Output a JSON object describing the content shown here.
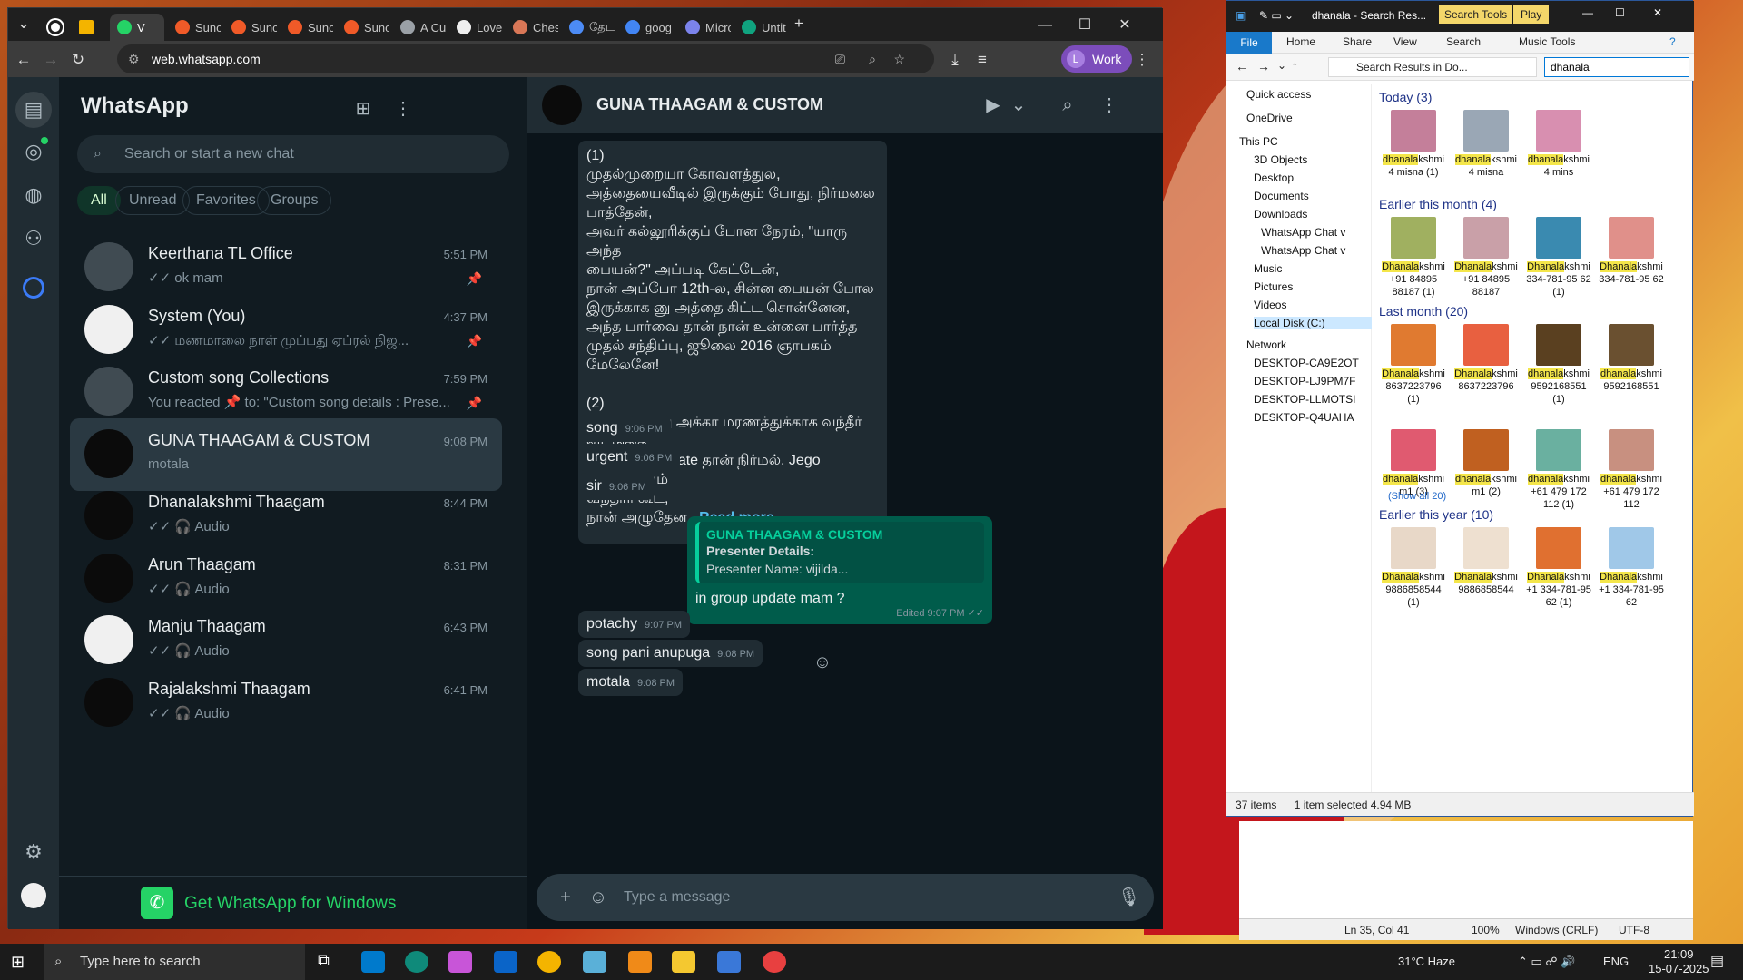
{
  "browser": {
    "tabs": [
      {
        "label": "V",
        "color": "#25d366"
      },
      {
        "label": "Suno",
        "color": "#f05a28"
      },
      {
        "label": "Suno",
        "color": "#f05a28"
      },
      {
        "label": "Suno",
        "color": "#f05a28"
      },
      {
        "label": "Suno",
        "color": "#f05a28"
      },
      {
        "label": "A Cus",
        "color": "#9aa0a6"
      },
      {
        "label": "Love",
        "color": "#eeeeee"
      },
      {
        "label": "Ches",
        "color": "#d97757"
      },
      {
        "label": "தேட",
        "color": "#4c8bf5"
      },
      {
        "label": "goog",
        "color": "#4285f4"
      },
      {
        "label": "Micro",
        "color": "#7b83eb"
      },
      {
        "label": "Untit",
        "color": "#10a37f"
      }
    ],
    "url": "web.whatsapp.com",
    "profile_initial": "L",
    "profile_label": "Work"
  },
  "whatsapp": {
    "title": "WhatsApp",
    "search_placeholder": "Search or start a new chat",
    "filters": [
      "All",
      "Unread",
      "Favorites",
      "Groups"
    ],
    "chats": [
      {
        "name": "Keerthana TL Office",
        "time": "5:51 PM",
        "snippet": "✓✓ ok mam",
        "pinned": true
      },
      {
        "name": "System (You)",
        "time": "4:37 PM",
        "snippet": "✓✓ மணமாலை நாள் முப்பது ஏப்ரல் நிஜ...",
        "pinned": true
      },
      {
        "name": "Custom song Collections",
        "time": "7:59 PM",
        "snippet": "You reacted 📌 to: \"Custom song details : Prese...",
        "pinned": true
      },
      {
        "name": "GUNA THAAGAM & CUSTOM",
        "time": "9:08 PM",
        "snippet": "motala",
        "pinned": false
      },
      {
        "name": "Dhanalakshmi Thaagam",
        "time": "8:44 PM",
        "snippet": "✓✓ 🎧 Audio",
        "pinned": false
      },
      {
        "name": "Arun Thaagam",
        "time": "8:31 PM",
        "snippet": "✓✓ 🎧 Audio",
        "pinned": false
      },
      {
        "name": "Manju Thaagam",
        "time": "6:43 PM",
        "snippet": "✓✓ 🎧 Audio",
        "pinned": false
      },
      {
        "name": "Rajalakshmi Thaagam",
        "time": "6:41 PM",
        "snippet": "✓✓ 🎧 Audio",
        "pinned": false
      }
    ],
    "get_app": "Get WhatsApp for Windows",
    "conversation": {
      "title": "GUNA THAAGAM & CUSTOM",
      "long_message": "(1)\nமுதல்முறையா கோவளத்துல,\nஅத்தையைவீடில் இருக்கும் போது, நிர்மலை\nபாத்தேன்,\nஅவர் கல்லூரிக்குப் போன நேரம், \"யாரு அந்த\nபையன்?\" அப்படி கேட்டேன்,\nநான் அப்போ 12th-ல, சின்ன பையன் போல\nஇருக்காக னு அத்தை கிட்ட சொன்னேன,\nஅந்த பார்வை தான் நான் உன்னை பார்த்த\nமுதல் சந்திப்பு, ஜூலை 2016 ஞாபகம்\nமேலேனே!\n\n(2)\nஇரண்டாவது அக்கா மரணத்துக்காக வந்தீர்\nவீட்டுக்கு,\nஅக்கா classmate தான் நிர்மல், Jego அண்ணனும்\nவந்தார் கூட,\nநான் அழுதேன...",
      "read_more": "Read more",
      "long_message_time": "9:06 PM",
      "messages_in": [
        {
          "text": "song",
          "time": "9:06 PM"
        },
        {
          "text": "urgent",
          "time": "9:06 PM"
        },
        {
          "text": "sir",
          "time": "9:06 PM"
        }
      ],
      "outgoing": {
        "quote_name": "GUNA THAAGAM & CUSTOM",
        "quote_line1": "Presenter Details:",
        "quote_line2": "Presenter Name: vijilda...",
        "text": "in group update mam ?",
        "meta": "Edited 9:07 PM ✓✓"
      },
      "messages_in_2": [
        {
          "text": "potachy",
          "time": "9:07 PM"
        },
        {
          "text": "song pani anupuga",
          "time": "9:08 PM"
        },
        {
          "text": "motala",
          "time": "9:08 PM"
        }
      ],
      "composer_placeholder": "Type a message"
    }
  },
  "explorer": {
    "title": "dhanala - Search Res...",
    "search_tools": "Search Tools",
    "play": "Play",
    "ribbon": [
      "File",
      "Home",
      "Share",
      "View",
      "Search",
      "Music Tools"
    ],
    "path": "Search Results in Do...",
    "search_value": "dhanala",
    "sidebar": [
      "Quick access",
      "OneDrive",
      "This PC",
      "3D Objects",
      "Desktop",
      "Documents",
      "Downloads",
      "WhatsApp Chat v",
      "WhatsApp Chat v",
      "Music",
      "Pictures",
      "Videos",
      "Local Disk (C:)",
      "Network",
      "DESKTOP-CA9E2OT",
      "DESKTOP-LJ9PM7F",
      "DESKTOP-LLMOTSI",
      "DESKTOP-Q4UAHA"
    ],
    "groups": {
      "today": "Today (3)",
      "earlier_month": "Earlier this month (4)",
      "last_month": "Last month (20)",
      "show_all": "(Show all 20)",
      "earlier_year": "Earlier this year (10)"
    },
    "today_files": [
      {
        "hl": "dhanala",
        "rest": "kshmi 4 misna (1)",
        "color": "#c47f9a"
      },
      {
        "hl": "dhanala",
        "rest": "kshmi 4 misna",
        "color": "#9aa7b5"
      },
      {
        "hl": "dhanala",
        "rest": "kshmi 4 mins",
        "color": "#d88fb0"
      }
    ],
    "month_files": [
      {
        "hl": "Dhanala",
        "rest": "kshmi +91 84895 88187 (1)",
        "color": "#a0b060"
      },
      {
        "hl": "Dhanala",
        "rest": "kshmi +91 84895 88187",
        "color": "#c9a0a8"
      },
      {
        "hl": "Dhanala",
        "rest": "kshmi 334-781-95 62 (1)",
        "color": "#3a8ab0"
      },
      {
        "hl": "Dhanala",
        "rest": "kshmi 334-781-95 62",
        "color": "#e0908a"
      }
    ],
    "last_month_files": [
      {
        "hl": "Dhanala",
        "rest": "kshmi 8637223796 (1)",
        "color": "#e07a30"
      },
      {
        "hl": "Dhanala",
        "rest": "kshmi 8637223796",
        "color": "#e86040"
      },
      {
        "hl": "dhanala",
        "rest": "kshmi 9592168551 (1)",
        "color": "#5a4020"
      },
      {
        "hl": "dhanala",
        "rest": "kshmi 9592168551",
        "color": "#6a5030"
      },
      {
        "hl": "dhanala",
        "rest": "kshmi m1 (3)",
        "color": "#e05a70"
      },
      {
        "hl": "dhanala",
        "rest": "kshmi m1 (2)",
        "color": "#c06020"
      },
      {
        "hl": "dhanala",
        "rest": "kshmi +61 479 172 112 (1)",
        "color": "#6ab0a0"
      },
      {
        "hl": "dhanala",
        "rest": "kshmi +61 479 172 112",
        "color": "#c89080"
      }
    ],
    "year_files": [
      {
        "hl": "Dhanala",
        "rest": "kshmi 9886858544 (1)",
        "color": "#e8d8c8"
      },
      {
        "hl": "Dhanala",
        "rest": "kshmi 9886858544",
        "color": "#eee0d0"
      },
      {
        "hl": "Dhanala",
        "rest": "kshmi +1 334-781-95 62 (1)",
        "color": "#e07030"
      },
      {
        "hl": "Dhanala",
        "rest": "kshmi +1 334-781-95 62",
        "color": "#a0c8e8"
      }
    ],
    "status_items": "37 items",
    "status_selected": "1 item selected  4.94 MB"
  },
  "notepad": {
    "position": "Ln 35, Col 41",
    "zoom": "100%",
    "eol": "Windows (CRLF)",
    "encoding": "UTF-8"
  },
  "taskbar": {
    "search_placeholder": "Type here to search",
    "weather": "31°C  Haze",
    "lang": "ENG",
    "time": "21:09",
    "date": "15-07-2025"
  }
}
